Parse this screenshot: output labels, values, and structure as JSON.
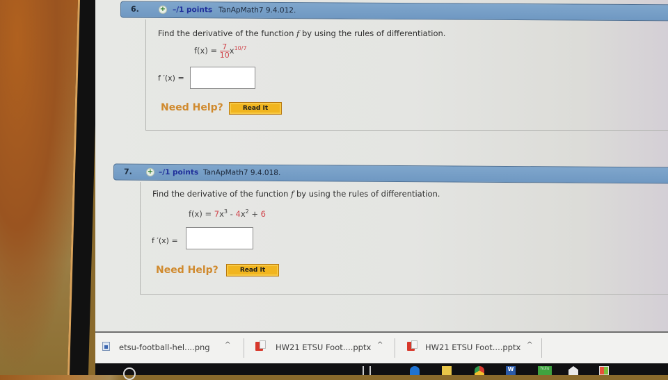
{
  "questions": [
    {
      "number": "6.",
      "points": "–/1 points",
      "source": "TanApMath7 9.4.012.",
      "prompt_before": "Find the derivative of the function ",
      "prompt_var": "f",
      "prompt_after": " by using the rules of differentiation.",
      "function_label": "f(x) =",
      "function_coef_num": "7",
      "function_coef_den": "10",
      "function_var": "x",
      "function_exp": "10/7",
      "derivative_label": "f ′(x) =",
      "answer_value": "",
      "need_help": "Need Help?",
      "read_it": "Read It"
    },
    {
      "number": "7.",
      "points": "–/1 points",
      "source": "TanApMath7 9.4.018.",
      "prompt_before": "Find the derivative of the function ",
      "prompt_var": "f",
      "prompt_after": " by using the rules of differentiation.",
      "function_label": "f(x) =",
      "term1_coef": "7",
      "term1_var": "x",
      "term1_exp": "3",
      "op1": " - ",
      "term2_coef": "4",
      "term2_var": "x",
      "term2_exp": "2",
      "op2": " + ",
      "term3": "6",
      "derivative_label": "f ′(x) =",
      "answer_value": "",
      "need_help": "Need Help?",
      "read_it": "Read It"
    }
  ],
  "downloads": [
    {
      "name": "etsu-football-hel....png",
      "icon": "image-file-icon"
    },
    {
      "name": "HW21 ETSU Foot....pptx",
      "icon": "powerpoint-file-icon"
    },
    {
      "name": "HW21 ETSU Foot....pptx",
      "icon": "powerpoint-file-icon"
    }
  ],
  "caret_glyph": "^",
  "taskbar": {
    "apps": [
      "task-view",
      "edge",
      "file-explorer",
      "chrome",
      "word",
      "hulu",
      "mail",
      "store"
    ],
    "word_label": "W",
    "hulu_label": "hulu"
  },
  "colors": {
    "header_blue": "#7fa6cc",
    "points_blue": "#1f2f9a",
    "math_red": "#d0444b",
    "need_help_orange": "#d08a2e",
    "read_it_yellow": "#f1b51f"
  }
}
